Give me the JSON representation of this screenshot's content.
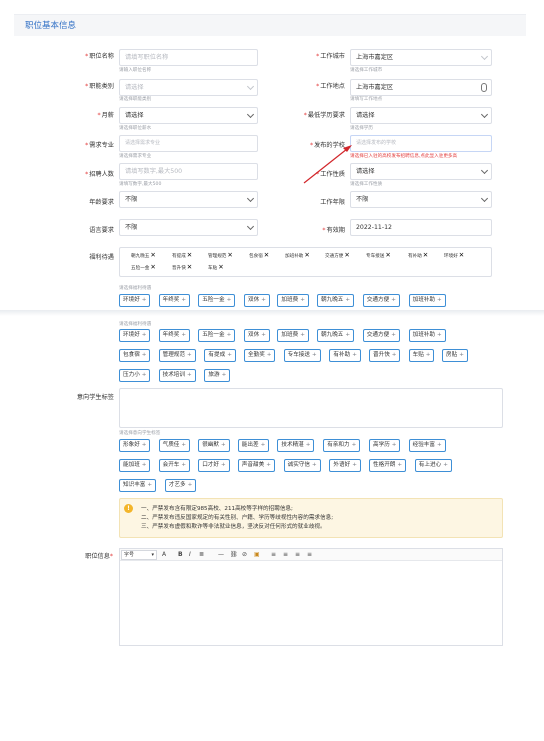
{
  "section": {
    "title": "职位基本信息"
  },
  "form": {
    "job_name": {
      "label": "职位名称",
      "placeholder": "请填写职位名称",
      "hint": "请输入职位名称"
    },
    "work_city": {
      "label": "工作城市",
      "value": "上海市嘉定区",
      "hint": "请选择工作城市"
    },
    "job_category": {
      "label": "职能类别",
      "placeholder": "请选择",
      "hint": "请选择职能类别"
    },
    "work_location": {
      "label": "工作地点",
      "value": "上海市嘉定区",
      "hint": "请填写工作地点"
    },
    "salary": {
      "label": "月薪",
      "value": "请选择",
      "hint": "请选择职位薪水"
    },
    "min_education": {
      "label": "最低学历要求",
      "value": "请选择",
      "hint": "请选择学历"
    },
    "major": {
      "label": "需求专业",
      "placeholder": "请选择需求专业",
      "hint": "请选择需求专业"
    },
    "publish_school": {
      "label": "发布的学校",
      "placeholder": "请选择发布的学校",
      "hint": "请选择已入驻的高校发布招聘信息,点此显入驻更多高"
    },
    "headcount": {
      "label": "招聘人数",
      "placeholder": "请填写数字,最大500",
      "hint": "请填写数字,最大500"
    },
    "job_nature": {
      "label": "工作性质",
      "value": "请选择",
      "hint": "请选择工作性质"
    },
    "age_req": {
      "label": "年龄要求",
      "value": "不限"
    },
    "work_years": {
      "label": "工作年限",
      "value": "不限"
    },
    "language_req": {
      "label": "语言要求",
      "value": "不限"
    },
    "valid_until": {
      "label": "有效期",
      "value": "2022-11-12"
    },
    "welfare": {
      "label": "福利待遇",
      "hint": "请选择福利待遇",
      "selected": [
        "朝九晚五",
        "有提成",
        "管理规范",
        "包食宿",
        "加班补助",
        "交通方便",
        "专车接送",
        "有补助",
        "环境好",
        "五险一金",
        "晋升快",
        "车贴"
      ],
      "options_row": [
        "环境好",
        "年终奖",
        "五险一金",
        "双休",
        "加班费",
        "朝九晚五",
        "交通方便",
        "加班补助"
      ]
    }
  },
  "lower": {
    "welfare_hint": "请选择福利待遇",
    "welfare_options": [
      "环境好",
      "年终奖",
      "五险一金",
      "双休",
      "加班费",
      "朝九晚五",
      "交通方便",
      "加班补助",
      "包食宿",
      "管理规范",
      "有提成",
      "全勤奖",
      "专车接送",
      "有补助",
      "晋升快",
      "车贴",
      "房贴",
      "压力小",
      "技术培训",
      "旅游"
    ],
    "student_tags": {
      "label": "意向学生标签",
      "hint": "请选择意向学生标签",
      "options": [
        "形象好",
        "气质佳",
        "很幽默",
        "能出差",
        "技术精湛",
        "有亲和力",
        "高学历",
        "经验丰富",
        "能加班",
        "会开车",
        "口才好",
        "声音甜美",
        "诚实守信",
        "外语好",
        "性格开朗",
        "有上进心",
        "知识丰富",
        "才艺多"
      ]
    },
    "notice": {
      "icon": "!",
      "lines": [
        "一、严禁发布含有限定985高校、211高校等字样的招聘信息;",
        "二、严禁发布违反国家规定的有关性别、户籍、学历等歧视性内容的需求信息;",
        "三、严禁发布虚假和欺诈等非法就业信息，坚决反对任何形式的就业歧视。"
      ]
    },
    "job_info": {
      "label": "职位信息",
      "font_size_label": "字号",
      "toolbar": [
        "A",
        "B",
        "I",
        "≣",
        "—",
        "⛓",
        "⊘",
        "▣",
        "≡",
        "≡",
        "≡",
        "≡"
      ]
    }
  },
  "colors": {
    "accent": "#2f6fc5",
    "tag_border": "#3e8fd6",
    "required": "#e23b3b",
    "arrow": "#d2262b",
    "notice_bg": "#fdf6e3"
  }
}
